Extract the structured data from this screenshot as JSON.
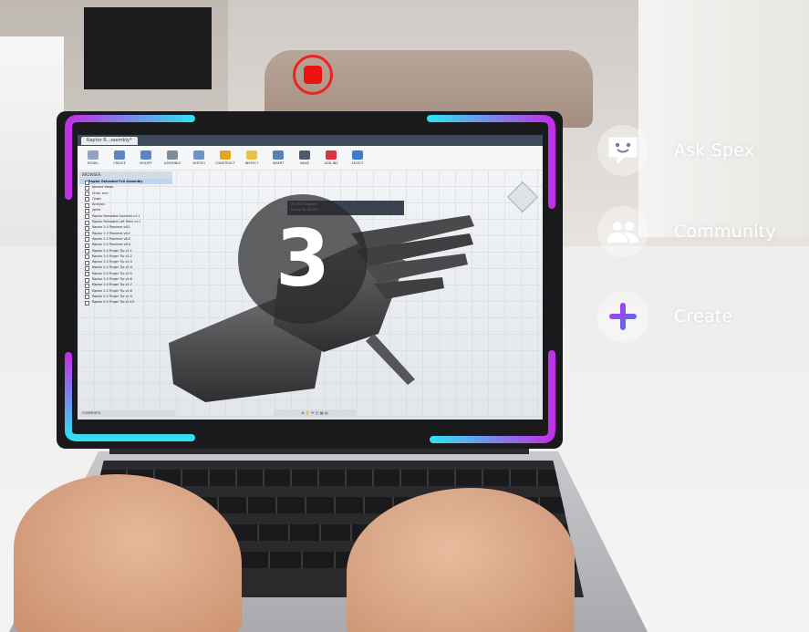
{
  "record": {
    "icon": "record-stop-icon",
    "color": "#ee1111"
  },
  "countdown": {
    "value": "3"
  },
  "menu": {
    "items": [
      {
        "label": "Ask Spex",
        "icon": "chat-bot-icon"
      },
      {
        "label": "Community",
        "icon": "people-icon"
      },
      {
        "label": "Create",
        "icon": "plus-icon"
      }
    ]
  },
  "frame": {
    "accent_start": "#c030e8",
    "accent_end": "#30e0f0"
  },
  "app": {
    "tab_title": "Raptor R...ssembly*",
    "toolbar": [
      "MODEL",
      "CREATE",
      "MODIFY",
      "ASSEMBLE",
      "SKETCH",
      "CONSTRUCT",
      "INSPECT",
      "INSERT",
      "MAKE",
      "ADD-INS",
      "SELECT"
    ],
    "browser": {
      "header": "BROWSER",
      "root": "Raptor Reloaded Full Assembly",
      "items": [
        "Named Views",
        "Units: mm",
        "Origin",
        "Analysis",
        "Joints",
        "Raptor Reloaded Gauntlet v1:1",
        "Raptor Reloaded Left Palm v1:1",
        "Raptor 2.0 Proximal v6:1",
        "Raptor 2.0 Proximal v6:2",
        "Raptor 2.0 Proximal v6:3",
        "Raptor 2.0 Proximal v6:4",
        "Raptor 2.0 Finger Tip v1:1",
        "Raptor 2.0 Finger Tip v1:2",
        "Raptor 2.0 Finger Tip v1:3",
        "Raptor 2.0 Finger Tip v1:4",
        "Raptor 2.0 Finger Tip v1:5",
        "Raptor 2.0 Finger Tip v1:6",
        "Raptor 2.0 Finger Tip v1:7",
        "Raptor 2.0 Finger Tip v1:8",
        "Raptor 2.0 Finger Tip v1:9",
        "Raptor 2.0 Finger Tip v1:10"
      ]
    },
    "export_menu": [
      "3D PDF Exporter",
      "Export To 3D PDF"
    ],
    "comments": "COMMENTS"
  }
}
